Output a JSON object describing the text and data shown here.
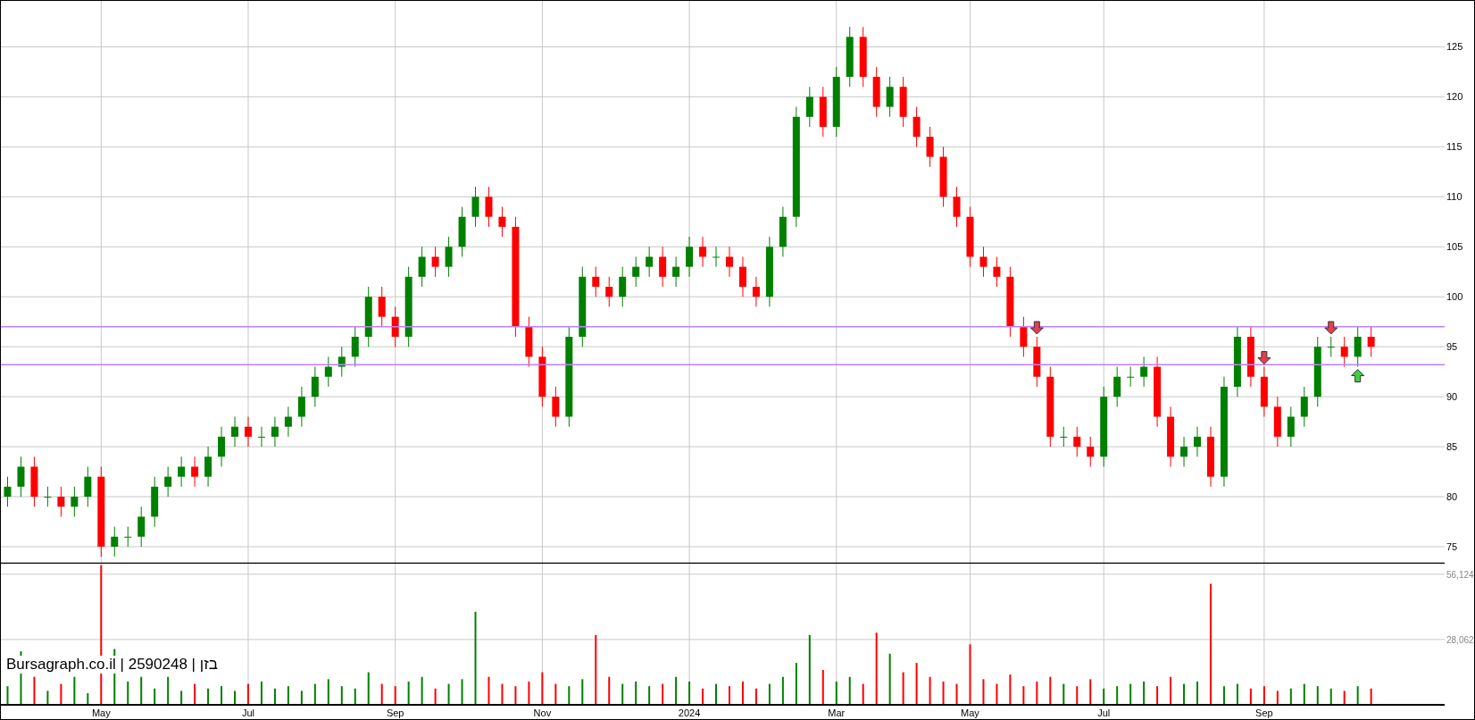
{
  "price_panel": {
    "chart_data": {
      "type": "candlestick",
      "grid": true,
      "ylim": [
        73.3,
        129.6
      ],
      "yticks": [
        75,
        80,
        85,
        90,
        95,
        100,
        105,
        110,
        115,
        120,
        125
      ],
      "categories": [
        null,
        null,
        null,
        null,
        null,
        null,
        null,
        null,
        null,
        null,
        null,
        null,
        null,
        null,
        null,
        null,
        null,
        null,
        null,
        null,
        null,
        null,
        null,
        null,
        null,
        null,
        null,
        null,
        null,
        null,
        null,
        null,
        null,
        null,
        null,
        null,
        null,
        null,
        null,
        null,
        null,
        null,
        null,
        null,
        null,
        null,
        null,
        null,
        null,
        null,
        null,
        null,
        null,
        null,
        null,
        null,
        null,
        null,
        null,
        null,
        null,
        null,
        null,
        null,
        null,
        null,
        null,
        null,
        null,
        null,
        null,
        null,
        null,
        null,
        null,
        null,
        null,
        null,
        null,
        null,
        null,
        null,
        null,
        null,
        null,
        null,
        null,
        null,
        null,
        null,
        null,
        null,
        null,
        null,
        null,
        null,
        null,
        null,
        null,
        null,
        null,
        null,
        null,
        null,
        null,
        null,
        null,
        null
      ],
      "ohlc": [
        [
          80,
          82,
          79,
          81
        ],
        [
          81,
          84,
          80,
          83
        ],
        [
          83,
          84,
          79,
          80
        ],
        [
          80,
          81,
          79,
          80
        ],
        [
          80,
          81,
          78,
          79
        ],
        [
          79,
          81,
          78,
          80
        ],
        [
          80,
          83,
          79,
          82
        ],
        [
          82,
          83,
          74,
          75
        ],
        [
          75,
          77,
          74,
          76
        ],
        [
          76,
          77,
          75,
          76
        ],
        [
          76,
          79,
          75,
          78
        ],
        [
          78,
          82,
          77,
          81
        ],
        [
          81,
          83,
          80,
          82
        ],
        [
          82,
          84,
          81,
          83
        ],
        [
          83,
          84,
          81,
          82
        ],
        [
          82,
          85,
          81,
          84
        ],
        [
          84,
          87,
          83,
          86
        ],
        [
          86,
          88,
          85,
          87
        ],
        [
          87,
          88,
          85,
          86
        ],
        [
          86,
          87,
          85,
          86
        ],
        [
          86,
          88,
          85,
          87
        ],
        [
          87,
          89,
          86,
          88
        ],
        [
          88,
          91,
          87,
          90
        ],
        [
          90,
          93,
          89,
          92
        ],
        [
          92,
          94,
          91,
          93
        ],
        [
          93,
          95,
          92,
          94
        ],
        [
          94,
          97,
          93,
          96
        ],
        [
          96,
          101,
          95,
          100
        ],
        [
          100,
          101,
          97,
          98
        ],
        [
          98,
          99,
          95,
          96
        ],
        [
          96,
          103,
          95,
          102
        ],
        [
          102,
          105,
          101,
          104
        ],
        [
          104,
          105,
          102,
          103
        ],
        [
          103,
          106,
          102,
          105
        ],
        [
          105,
          109,
          104,
          108
        ],
        [
          108,
          111,
          107,
          110
        ],
        [
          110,
          111,
          107,
          108
        ],
        [
          108,
          109,
          106,
          107
        ],
        [
          107,
          108,
          96,
          97
        ],
        [
          97,
          98,
          93,
          94
        ],
        [
          94,
          95,
          89,
          90
        ],
        [
          90,
          91,
          87,
          88
        ],
        [
          88,
          97,
          87,
          96
        ],
        [
          96,
          103,
          95,
          102
        ],
        [
          102,
          103,
          100,
          101
        ],
        [
          101,
          102,
          99,
          100
        ],
        [
          100,
          103,
          99,
          102
        ],
        [
          102,
          104,
          101,
          103
        ],
        [
          103,
          105,
          102,
          104
        ],
        [
          104,
          105,
          101,
          102
        ],
        [
          102,
          104,
          101,
          103
        ],
        [
          103,
          106,
          102,
          105
        ],
        [
          105,
          106,
          103,
          104
        ],
        [
          104,
          105,
          103,
          104
        ],
        [
          104,
          105,
          102,
          103
        ],
        [
          103,
          104,
          100,
          101
        ],
        [
          101,
          102,
          99,
          100
        ],
        [
          100,
          106,
          99,
          105
        ],
        [
          105,
          109,
          104,
          108
        ],
        [
          108,
          119,
          107,
          118
        ],
        [
          118,
          121,
          117,
          120
        ],
        [
          120,
          121,
          116,
          117
        ],
        [
          117,
          123,
          116,
          122
        ],
        [
          122,
          127,
          121,
          126
        ],
        [
          126,
          127,
          121,
          122
        ],
        [
          122,
          123,
          118,
          119
        ],
        [
          119,
          122,
          118,
          121
        ],
        [
          121,
          122,
          117,
          118
        ],
        [
          118,
          119,
          115,
          116
        ],
        [
          116,
          117,
          113,
          114
        ],
        [
          114,
          115,
          109,
          110
        ],
        [
          110,
          111,
          107,
          108
        ],
        [
          108,
          109,
          103,
          104
        ],
        [
          104,
          105,
          102,
          103
        ],
        [
          103,
          104,
          101,
          102
        ],
        [
          102,
          103,
          96,
          97
        ],
        [
          97,
          98,
          94,
          95
        ],
        [
          95,
          96,
          91,
          92
        ],
        [
          92,
          93,
          85,
          86
        ],
        [
          86,
          87,
          85,
          86
        ],
        [
          86,
          87,
          84,
          85
        ],
        [
          85,
          86,
          83,
          84
        ],
        [
          84,
          91,
          83,
          90
        ],
        [
          90,
          93,
          89,
          92
        ],
        [
          92,
          93,
          91,
          92
        ],
        [
          92,
          94,
          91,
          93
        ],
        [
          93,
          94,
          87,
          88
        ],
        [
          88,
          89,
          83,
          84
        ],
        [
          84,
          86,
          83,
          85
        ],
        [
          85,
          87,
          84,
          86
        ],
        [
          86,
          87,
          81,
          82
        ],
        [
          82,
          92,
          81,
          91
        ],
        [
          91,
          97,
          90,
          96
        ],
        [
          96,
          97,
          91,
          92
        ],
        [
          92,
          93,
          88,
          89
        ],
        [
          89,
          90,
          85,
          86
        ],
        [
          86,
          89,
          85,
          88
        ],
        [
          88,
          91,
          87,
          90
        ],
        [
          90,
          96,
          89,
          95
        ],
        [
          95,
          96,
          94,
          95
        ],
        [
          95,
          96,
          93,
          94
        ],
        [
          94,
          97,
          93,
          96
        ],
        [
          96,
          97,
          94,
          95
        ],
        null,
        null,
        null,
        null,
        null
      ],
      "ref_lines": [
        {
          "axis": "y",
          "value": 97
        },
        {
          "axis": "y",
          "value": 93.2
        }
      ]
    },
    "signal_arrows": [
      null,
      null,
      null,
      null,
      null,
      null,
      null,
      null,
      null,
      null,
      null,
      null,
      null,
      null,
      null,
      null,
      null,
      null,
      null,
      null,
      null,
      null,
      null,
      null,
      null,
      null,
      null,
      null,
      null,
      null,
      null,
      null,
      null,
      null,
      null,
      null,
      null,
      null,
      null,
      null,
      null,
      null,
      null,
      null,
      null,
      null,
      null,
      null,
      null,
      null,
      null,
      null,
      null,
      null,
      null,
      null,
      null,
      null,
      null,
      null,
      null,
      null,
      null,
      null,
      null,
      null,
      null,
      null,
      null,
      null,
      null,
      null,
      null,
      null,
      null,
      null,
      null,
      {
        "kind": "down"
      },
      null,
      null,
      null,
      null,
      null,
      null,
      null,
      null,
      null,
      null,
      null,
      null,
      null,
      null,
      null,
      null,
      {
        "kind": "down"
      },
      null,
      null,
      null,
      null,
      {
        "kind": "down"
      },
      null,
      {
        "kind": "up"
      },
      null,
      null,
      null,
      null,
      null,
      null
    ]
  },
  "volume_panel": {
    "chart_data": {
      "type": "bar",
      "grid": true,
      "ylim": [
        0,
        60660
      ],
      "yticks": [
        {
          "value": 28062,
          "label": "28,062"
        },
        {
          "value": 56124,
          "label": "56,124"
        }
      ],
      "categories": [
        null,
        null,
        null,
        null,
        null,
        null,
        null,
        "May",
        null,
        null,
        null,
        null,
        null,
        null,
        null,
        null,
        null,
        null,
        "Jul",
        null,
        null,
        null,
        null,
        null,
        null,
        null,
        null,
        null,
        null,
        "Sep",
        null,
        null,
        null,
        null,
        null,
        null,
        null,
        null,
        null,
        null,
        "Nov",
        null,
        null,
        null,
        null,
        null,
        null,
        null,
        null,
        null,
        null,
        "2024",
        null,
        null,
        null,
        null,
        null,
        null,
        null,
        null,
        null,
        null,
        "Mar",
        null,
        null,
        null,
        null,
        null,
        null,
        null,
        null,
        null,
        "May",
        null,
        null,
        null,
        null,
        null,
        null,
        null,
        null,
        null,
        "Jul",
        null,
        null,
        null,
        null,
        null,
        null,
        null,
        null,
        null,
        null,
        null,
        "Sep",
        null,
        null,
        null,
        null,
        null,
        null,
        null,
        null,
        null,
        null,
        null,
        null,
        null
      ],
      "series": [
        {
          "color": "#008000",
          "values": [
            8000,
            23000,
            null,
            6000,
            null,
            12000,
            5000,
            null,
            24000,
            10000,
            12000,
            7000,
            12000,
            6000,
            null,
            7000,
            8000,
            6000,
            null,
            10000,
            7000,
            8000,
            6000,
            9000,
            11000,
            8000,
            7000,
            14000,
            null,
            null,
            10000,
            12000,
            null,
            9000,
            11000,
            40000,
            null,
            null,
            null,
            null,
            null,
            null,
            8000,
            11000,
            null,
            null,
            9000,
            10000,
            8000,
            null,
            12000,
            10000,
            null,
            9000,
            null,
            null,
            null,
            9000,
            12000,
            18000,
            30000,
            null,
            10000,
            12000,
            null,
            null,
            22000,
            null,
            null,
            null,
            null,
            null,
            null,
            null,
            null,
            null,
            null,
            null,
            null,
            9000,
            null,
            null,
            7000,
            8000,
            9000,
            10000,
            null,
            null,
            9000,
            10000,
            null,
            8000,
            9000,
            null,
            null,
            null,
            7000,
            9000,
            8000,
            7000,
            null,
            8000,
            null,
            null,
            null,
            null,
            null,
            null
          ]
        },
        {
          "color": "#ff0000",
          "values": [
            null,
            null,
            12000,
            null,
            9000,
            null,
            null,
            60000,
            null,
            null,
            null,
            null,
            null,
            null,
            9000,
            null,
            null,
            null,
            9000,
            null,
            null,
            null,
            null,
            null,
            null,
            null,
            null,
            null,
            9000,
            8000,
            null,
            null,
            7000,
            null,
            null,
            null,
            12000,
            9000,
            8000,
            10000,
            14000,
            9000,
            null,
            null,
            30000,
            12000,
            null,
            null,
            null,
            9000,
            null,
            null,
            7000,
            null,
            8000,
            10000,
            7000,
            null,
            null,
            null,
            null,
            15000,
            null,
            null,
            9000,
            31000,
            null,
            14000,
            18000,
            12000,
            10000,
            9000,
            26000,
            11000,
            9000,
            13000,
            8000,
            10000,
            12000,
            null,
            8000,
            11000,
            null,
            null,
            null,
            null,
            8000,
            12000,
            null,
            null,
            52000,
            null,
            null,
            7000,
            8000,
            6000,
            null,
            null,
            null,
            null,
            6000,
            null,
            7000,
            null,
            null,
            null,
            null,
            null
          ]
        }
      ]
    }
  },
  "source_label": "Bursagraph.co.il | 2590248 | בזן"
}
